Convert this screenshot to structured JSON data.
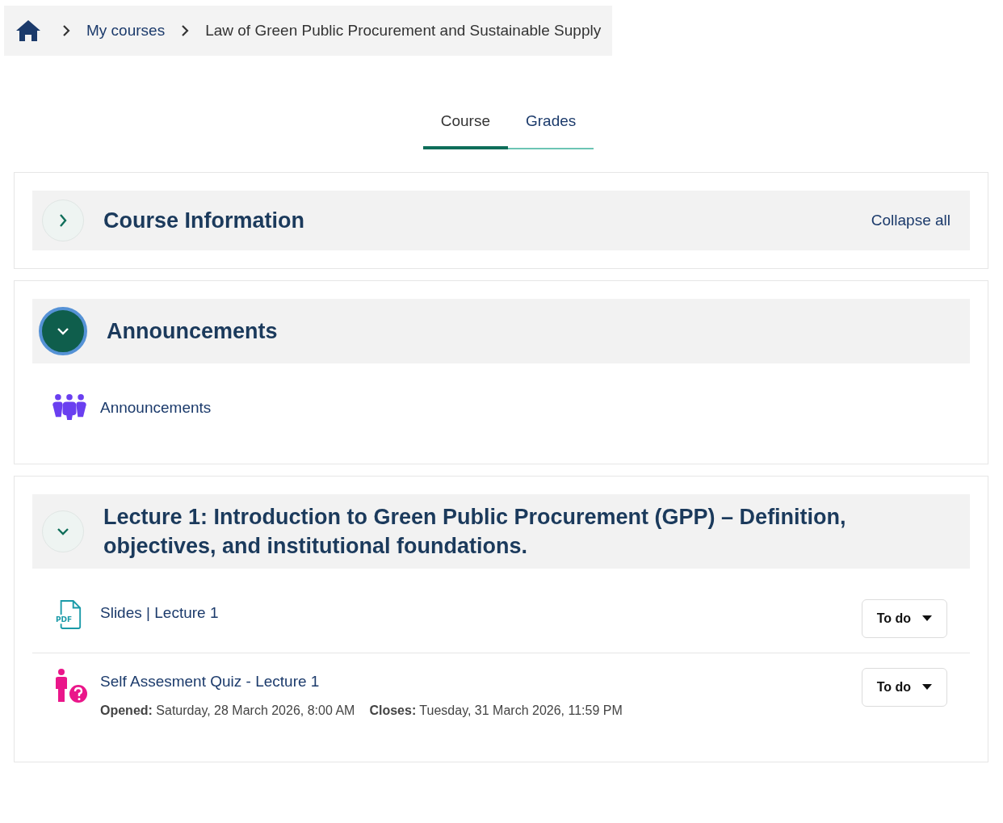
{
  "breadcrumb": {
    "items": [
      {
        "label": "My courses",
        "link": true
      },
      {
        "label": "Law of Green Public Procurement and Sustainable Supply",
        "link": false
      }
    ]
  },
  "tabs": [
    {
      "label": "Course",
      "selected": true
    },
    {
      "label": "Grades",
      "selected": false
    }
  ],
  "sections": [
    {
      "title": "Course Information",
      "expanded": false,
      "focused": false,
      "action": "Collapse all"
    },
    {
      "title": "Announcements",
      "expanded": true,
      "focused": true,
      "activities": [
        {
          "kind": "forum",
          "name": "Announcements"
        }
      ]
    },
    {
      "title": "Lecture 1: Introduction to Green Public Procurement (GPP) – Definition, objectives, and institutional foundations.",
      "expanded": true,
      "focused": false,
      "activities": [
        {
          "kind": "pdf",
          "icon_text": "PDF",
          "name": "Slides | Lecture 1",
          "status": "To do"
        },
        {
          "kind": "quiz",
          "name": "Self Assesment Quiz - Lecture 1",
          "status": "To do",
          "dates": [
            "**Opened:** Saturday, 28 March 2026, 8:00 AM",
            "**Closes:** Tuesday, 31 March 2026, 11:59 PM"
          ]
        }
      ]
    }
  ]
}
